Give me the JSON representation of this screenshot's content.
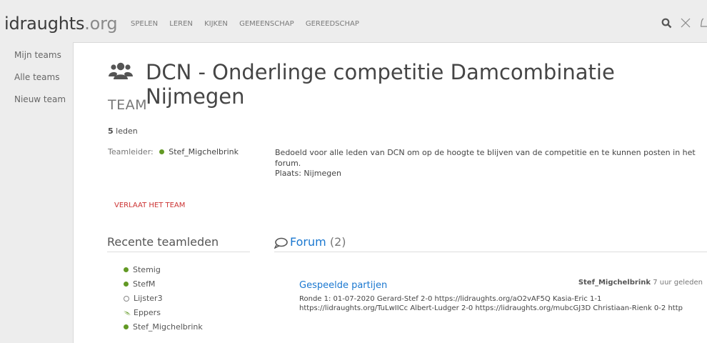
{
  "header": {
    "logo_main": "idraughts",
    "logo_tld": ".org",
    "nav": [
      "SPELEN",
      "LEREN",
      "KIJKEN",
      "GEMEENSCHAP",
      "GEREEDSCHAP"
    ]
  },
  "sidebar": {
    "items": [
      "Mijn teams",
      "Alle teams",
      "Nieuw team"
    ]
  },
  "team": {
    "name": "DCN - Onderlinge competitie Damcombinatie Nijmegen",
    "type_label": "TEAM",
    "member_count": "5",
    "members_word": "leden",
    "leader_label": "Teamleider:",
    "leader_name": "Stef_Migchelbrink",
    "description": "Bedoeld voor alle leden van DCN om op de hoogte te blijven van de competitie en te kunnen posten in het forum.",
    "location": "Plaats: Nijmegen",
    "leave_button": "VERLAAT HET TEAM"
  },
  "recent_members": {
    "title": "Recente teamleden",
    "items": [
      "Stemig",
      "StefM",
      "Lijster3",
      "Eppers",
      "Stef_Migchelbrink"
    ]
  },
  "forum": {
    "title": "Forum",
    "count": "(2)",
    "post": {
      "title": "Gespeelde partijen",
      "author": "Stef_Migchelbrink",
      "time": "7 uur geleden",
      "excerpt": "Ronde 1: 01-07-2020 Gerard-Stef 2-0 https://lidraughts.org/aO2vAF5Q Kasia-Eric 1-1 https://lidraughts.org/TuLwIICc Albert-Ludger 2-0 https://lidraughts.org/mubcGJ3D Christiaan-Rienk 0-2 http"
    }
  },
  "colors": {
    "accent": "#1b78d0",
    "online": "#629924",
    "danger": "#c33"
  }
}
